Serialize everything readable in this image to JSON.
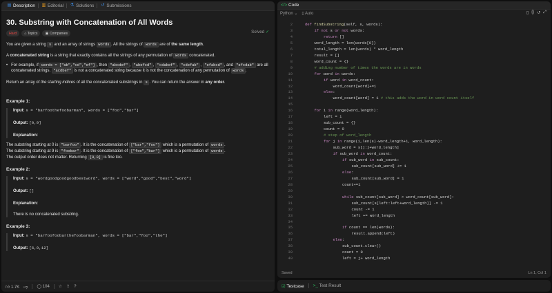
{
  "left_tabs": [
    {
      "label": "Description",
      "icon": "document-icon",
      "active": true
    },
    {
      "label": "Editorial",
      "icon": "book-icon",
      "active": false
    },
    {
      "label": "Solutions",
      "icon": "flask-icon",
      "active": false
    },
    {
      "label": "Submissions",
      "icon": "history-icon",
      "active": false
    }
  ],
  "problem": {
    "title": "30. Substring with Concatenation of All Words",
    "solved": "Solved",
    "difficulty": "Hard",
    "topics": "Topics",
    "companies": "Companies",
    "p1_a": "You are given a string ",
    "p1_s": "s",
    "p1_b": " and an array of strings ",
    "p1_words": "words",
    "p1_c": ". All the strings of ",
    "p1_words2": "words",
    "p1_d": " are of ",
    "p1_bold": "the same length",
    "p1_e": ".",
    "p2_a": "A ",
    "p2_bold": "concatenated string",
    "p2_b": " is a string that exactly contains all the strings of any permutation of ",
    "p2_words": "words",
    "p2_c": " concatenated.",
    "bullet_a": "For example, if ",
    "bullet_code": "words = [\"ab\",\"cd\",\"ef\"]",
    "bullet_b": ", then ",
    "bullet_c1": "\"abcdef\"",
    "bullet_sep1": ", ",
    "bullet_c2": "\"abefcd\"",
    "bullet_sep2": ", ",
    "bullet_c3": "\"cdabef\"",
    "bullet_sep3": ", ",
    "bullet_c4": "\"cdefab\"",
    "bullet_sep4": ", ",
    "bullet_c5": "\"efabcd\"",
    "bullet_sep5": ", and ",
    "bullet_c6": "\"efcdab\"",
    "bullet_c": " are all concatenated strings. ",
    "bullet_c7": "\"acdbef\"",
    "bullet_d": " is not a concatenated string because it is not the concatenation of any permutation of ",
    "bullet_words": "words",
    "bullet_e": ".",
    "p3_a": "Return an array of ",
    "p3_it": "the starting indices",
    "p3_b": " of all the concatenated substrings in ",
    "p3_s": "s",
    "p3_c": ". You can return the answer in ",
    "p3_bold": "any order",
    "p3_d": "."
  },
  "examples": [
    {
      "heading": "Example 1:",
      "input_label": "Input:",
      "input": "s = \"barfoothefoobarman\", words = [\"foo\",\"bar\"]",
      "output_label": "Output:",
      "output": "[0,9]",
      "expl_label": "Explanation:",
      "expl": [
        {
          "a": "The substring starting at 0 is ",
          "c1": "\"barfoo\"",
          "b": ". It is the concatenation of ",
          "c2": "[\"bar\",\"foo\"]",
          "c": " which is a permutation of ",
          "c3": "words",
          "d": "."
        },
        {
          "a": "The substring starting at 9 is ",
          "c1": "\"foobar\"",
          "b": ". It is the concatenation of ",
          "c2": "[\"foo\",\"bar\"]",
          "c": " which is a permutation of ",
          "c3": "words",
          "d": "."
        }
      ],
      "expl_tail_a": "The output order does not matter. Returning ",
      "expl_tail_code": "[9,0]",
      "expl_tail_b": " is fine too."
    },
    {
      "heading": "Example 2:",
      "input_label": "Input:",
      "input": "s = \"wordgoodgoodgoodbestword\", words = [\"word\",\"good\",\"best\",\"word\"]",
      "output_label": "Output:",
      "output": "[]",
      "expl_label": "Explanation:",
      "expl_text": "There is no concatenated substring."
    },
    {
      "heading": "Example 3:",
      "input_label": "Input:",
      "input": "s = \"barfoofoobarthefoobarman\", words = [\"bar\",\"foo\",\"the\"]",
      "output_label": "Output:",
      "output": "[6,9,12]"
    }
  ],
  "footer": {
    "likes": "1.7K",
    "comments": "104"
  },
  "code_panel": {
    "title": "Code",
    "language": "Python",
    "auto": "Auto",
    "saved": "Saved",
    "cursor": "Ln 1, Col 1"
  },
  "code_lines": [
    {
      "n": "2",
      "i": 1,
      "t": "def findSubstring(self, s, words):",
      "k": "def"
    },
    {
      "n": "3",
      "i": 2,
      "t": "if not s or not words:",
      "k": "kw"
    },
    {
      "n": "4",
      "i": 3,
      "t": "return []",
      "k": "kw"
    },
    {
      "n": "5",
      "i": 2,
      "t": "word_length = len(words[0])",
      "k": ""
    },
    {
      "n": "6",
      "i": 2,
      "t": "total_length = len(words) * word_length",
      "k": ""
    },
    {
      "n": "7",
      "i": 2,
      "t": "result = []",
      "k": ""
    },
    {
      "n": "8",
      "i": 2,
      "t": "word_count = {}",
      "k": ""
    },
    {
      "n": "9",
      "i": 2,
      "t": "# adding number of times the words are in words",
      "k": "cm"
    },
    {
      "n": "10",
      "i": 2,
      "t": "for word in words:",
      "k": "kw"
    },
    {
      "n": "11",
      "i": 3,
      "t": "if word in word_count:",
      "k": "kw"
    },
    {
      "n": "12",
      "i": 4,
      "t": "word_count[word]+=1",
      "k": ""
    },
    {
      "n": "13",
      "i": 3,
      "t": "else:",
      "k": "kw"
    },
    {
      "n": "14",
      "i": 4,
      "t": "word_count[word] = 1 # this adds the word in word count itself",
      "k": "mixcm"
    },
    {
      "n": "15",
      "i": 0,
      "t": "",
      "k": ""
    },
    {
      "n": "16",
      "i": 2,
      "t": "for i in range(word_length):",
      "k": "kw"
    },
    {
      "n": "17",
      "i": 3,
      "t": "left = i",
      "k": ""
    },
    {
      "n": "18",
      "i": 3,
      "t": "sub_count = {}",
      "k": ""
    },
    {
      "n": "19",
      "i": 3,
      "t": "count = 0",
      "k": ""
    },
    {
      "n": "20",
      "i": 3,
      "t": "# step of word_length",
      "k": "cm"
    },
    {
      "n": "21",
      "i": 3,
      "t": "for j in range(i,len(s)-word_length+1, word_length):",
      "k": "kw"
    },
    {
      "n": "22",
      "i": 4,
      "t": "sub_word = s[j:j+word_length]",
      "k": ""
    },
    {
      "n": "23",
      "i": 4,
      "t": "if sub_word in word_count:",
      "k": "kw"
    },
    {
      "n": "24",
      "i": 5,
      "t": "if sub_word in sub_count:",
      "k": "kw"
    },
    {
      "n": "25",
      "i": 6,
      "t": "sub_count[sub_word] += 1",
      "k": ""
    },
    {
      "n": "26",
      "i": 5,
      "t": "else:",
      "k": "kw"
    },
    {
      "n": "27",
      "i": 6,
      "t": "sub_count[sub_word] = 1",
      "k": ""
    },
    {
      "n": "28",
      "i": 5,
      "t": "count+=1",
      "k": ""
    },
    {
      "n": "29",
      "i": 0,
      "t": "",
      "k": ""
    },
    {
      "n": "30",
      "i": 5,
      "t": "while sub_count[sub_word] > word_count[sub_word]:",
      "k": "kw"
    },
    {
      "n": "31",
      "i": 6,
      "t": "sub_count[s[left:left+word_length]] -= 1",
      "k": ""
    },
    {
      "n": "32",
      "i": 6,
      "t": "count -= 1",
      "k": ""
    },
    {
      "n": "33",
      "i": 6,
      "t": "left += word_length",
      "k": ""
    },
    {
      "n": "34",
      "i": 0,
      "t": "",
      "k": ""
    },
    {
      "n": "35",
      "i": 5,
      "t": "if count == len(words):",
      "k": "kw"
    },
    {
      "n": "36",
      "i": 6,
      "t": "result.append(left)",
      "k": ""
    },
    {
      "n": "37",
      "i": 4,
      "t": "else:",
      "k": "kw"
    },
    {
      "n": "38",
      "i": 5,
      "t": "sub_count.clear()",
      "k": ""
    },
    {
      "n": "39",
      "i": 5,
      "t": "count = 0",
      "k": ""
    },
    {
      "n": "40",
      "i": 5,
      "t": "left = j+ word_length",
      "k": ""
    }
  ],
  "bottom_tabs": [
    {
      "label": "Testcase",
      "active": true
    },
    {
      "label": "Test Result",
      "active": false
    }
  ],
  "colors": {
    "accent_green": "#2cbb5d",
    "hard_red": "#ef4743",
    "keyword": "#c586c0",
    "comment": "#6a9955"
  }
}
